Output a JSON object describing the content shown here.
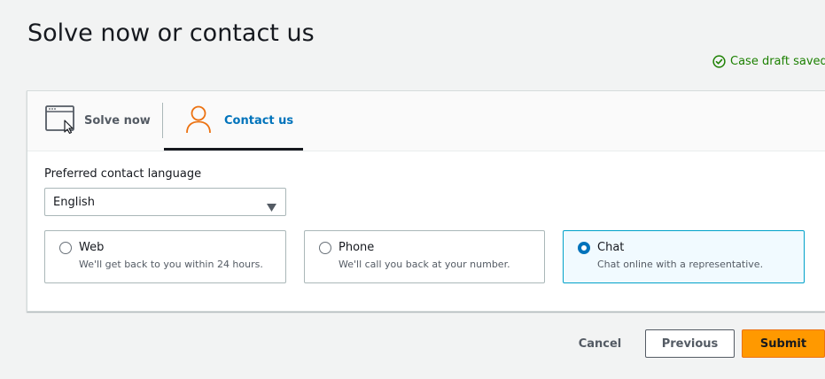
{
  "page": {
    "title": "Solve now or contact us"
  },
  "status": {
    "draft_saved": "Case draft saved",
    "icon": "check-circle-icon",
    "color": "#1d8102"
  },
  "tabs": [
    {
      "label": "Solve now",
      "icon": "browser-cursor-icon",
      "selected": false
    },
    {
      "label": "Contact us",
      "icon": "user-icon",
      "selected": true
    }
  ],
  "language": {
    "label": "Preferred contact language",
    "selected": "English"
  },
  "contact_options": [
    {
      "title": "Web",
      "description": "We'll get back to you within 24 hours.",
      "selected": false
    },
    {
      "title": "Phone",
      "description": "We'll call you back at your number.",
      "selected": false
    },
    {
      "title": "Chat",
      "description": "Chat online with a representative.",
      "selected": true
    }
  ],
  "actions": {
    "cancel": "Cancel",
    "previous": "Previous",
    "submit": "Submit"
  },
  "colors": {
    "accent": "#0073bb",
    "primary_button": "#ff9900",
    "selected_border": "#00a1c9",
    "user_icon": "#ec7211"
  }
}
